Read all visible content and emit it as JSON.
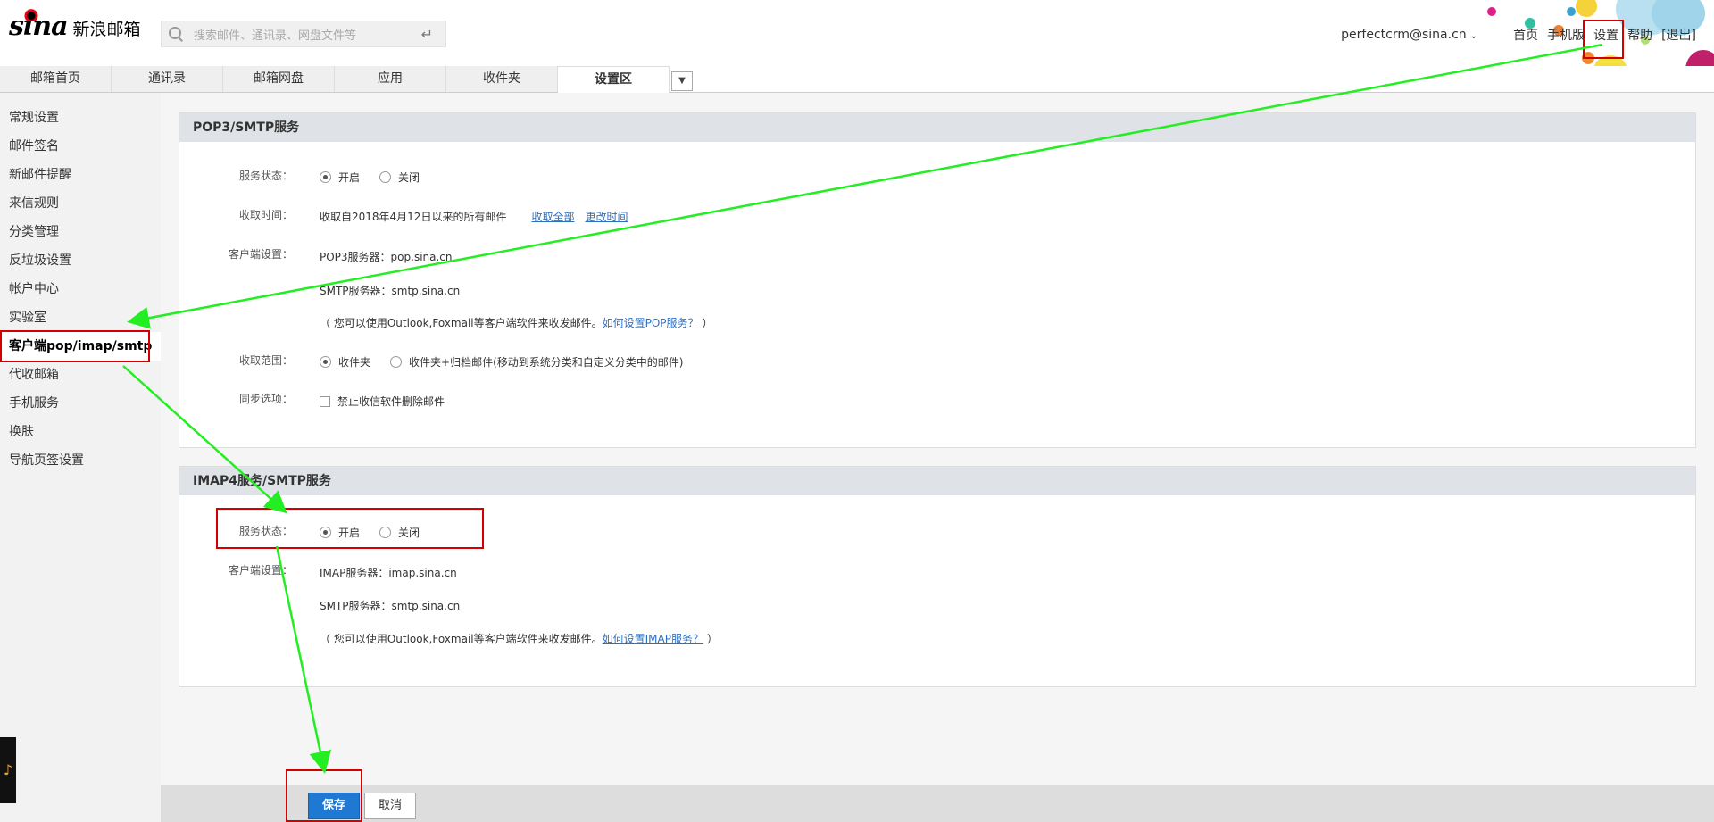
{
  "header": {
    "logo_text": "sina",
    "logo_product": "新浪邮箱",
    "search_placeholder": "搜索邮件、通讯录、网盘文件等",
    "user_email": "perfectcrm@sina.cn",
    "nav": [
      "首页",
      "手机版",
      "设置",
      "帮助",
      "[退出]"
    ]
  },
  "tabs": [
    "邮箱首页",
    "通讯录",
    "邮箱网盘",
    "应用",
    "收件夹",
    "设置区"
  ],
  "sidebar": {
    "items": [
      "常规设置",
      "邮件签名",
      "新邮件提醒",
      "来信规则",
      "分类管理",
      "反垃圾设置",
      "帐户中心",
      "实验室",
      "客户端pop/imap/smtp",
      "代收邮箱",
      "手机服务",
      "换肤",
      "导航页签设置"
    ],
    "active_index": 8
  },
  "pop3": {
    "title": "POP3/SMTP服务",
    "service_status_label": "服务状态：",
    "on": "开启",
    "off": "关闭",
    "fetch_time_label": "收取时间：",
    "fetch_time_text": "收取自2018年4月12日以来的所有邮件",
    "fetch_all_link": "收取全部",
    "change_time_link": "更改时间",
    "client_label": "客户端设置：",
    "pop3_server": "POP3服务器：pop.sina.cn",
    "smtp_server": "SMTP服务器：smtp.sina.cn",
    "hint_prefix": "（ 您可以使用Outlook,Foxmail等客户端软件来收发邮件。",
    "hint_link": "如何设置POP服务？",
    "hint_suffix": "）",
    "scope_label": "收取范围：",
    "scope_inbox": "收件夹",
    "scope_all": "收件夹+归档邮件(移动到系统分类和自定义分类中的邮件)",
    "sync_label": "同步选项：",
    "sync_option": "禁止收信软件删除邮件"
  },
  "imap": {
    "title": "IMAP4服务/SMTP服务",
    "service_status_label": "服务状态：",
    "on": "开启",
    "off": "关闭",
    "client_label": "客户端设置：",
    "imap_server": "IMAP服务器：imap.sina.cn",
    "smtp_server": "SMTP服务器：smtp.sina.cn",
    "hint_prefix": "（ 您可以使用Outlook,Foxmail等客户端软件来收发邮件。",
    "hint_link": "如何设置IMAP服务？",
    "hint_suffix": "）"
  },
  "footer": {
    "save": "保存",
    "cancel": "取消"
  },
  "colors": {
    "annotation_arrow": "#22ee22",
    "annotation_box": "#d40000",
    "save_button": "#1f78d1",
    "link": "#2b6fc2"
  }
}
